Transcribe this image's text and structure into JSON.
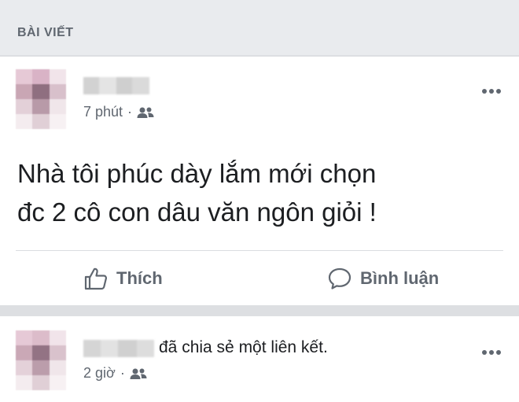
{
  "section": {
    "title": "BÀI VIẾT"
  },
  "posts": [
    {
      "time": "7 phút",
      "separator": "·",
      "audience_icon": "friends-icon",
      "text_line1": "Nhà tôi phúc dày lắm mới chọn",
      "text_line2": "đc 2 cô con dâu văn ngôn giỏi !",
      "actions": {
        "like": "Thích",
        "comment": "Bình luận"
      },
      "more_icon": "more-options-icon"
    },
    {
      "activity": "đã chia sẻ một liên kết.",
      "time": "2 giờ",
      "separator": "·",
      "audience_icon": "friends-icon",
      "more_icon": "more-options-icon"
    }
  ],
  "colors": {
    "background": "#dddfe2",
    "header_bg": "#e9ebee",
    "card_bg": "#ffffff",
    "text": "#1c1e21",
    "secondary_text": "#606770"
  }
}
